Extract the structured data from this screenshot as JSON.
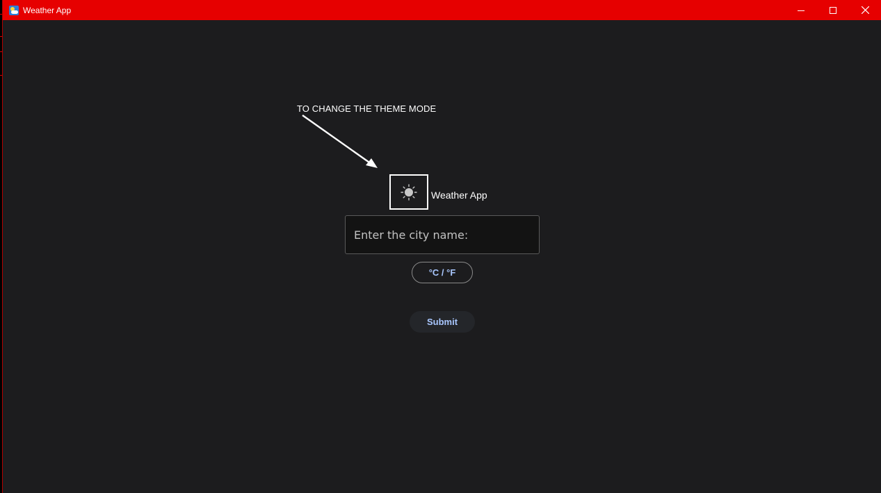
{
  "window": {
    "title": "Weather App",
    "app_icon": "weather-app-icon",
    "titlebar_color": "#e60000",
    "controls": [
      "minimize-icon",
      "maximize-icon",
      "close-icon"
    ]
  },
  "annotation": {
    "text": "TO CHANGE THE THEME MODE",
    "icon": "arrow-icon"
  },
  "theme_toggle": {
    "icon": "sun-icon"
  },
  "header": {
    "title": "Weather App"
  },
  "city_input": {
    "placeholder": "Enter the city name:",
    "value": ""
  },
  "unit_toggle": {
    "label": "°C / °F"
  },
  "submit": {
    "label": "Submit"
  },
  "colors": {
    "background": "#1c1c1e",
    "accent_text": "#a9c7ff"
  }
}
